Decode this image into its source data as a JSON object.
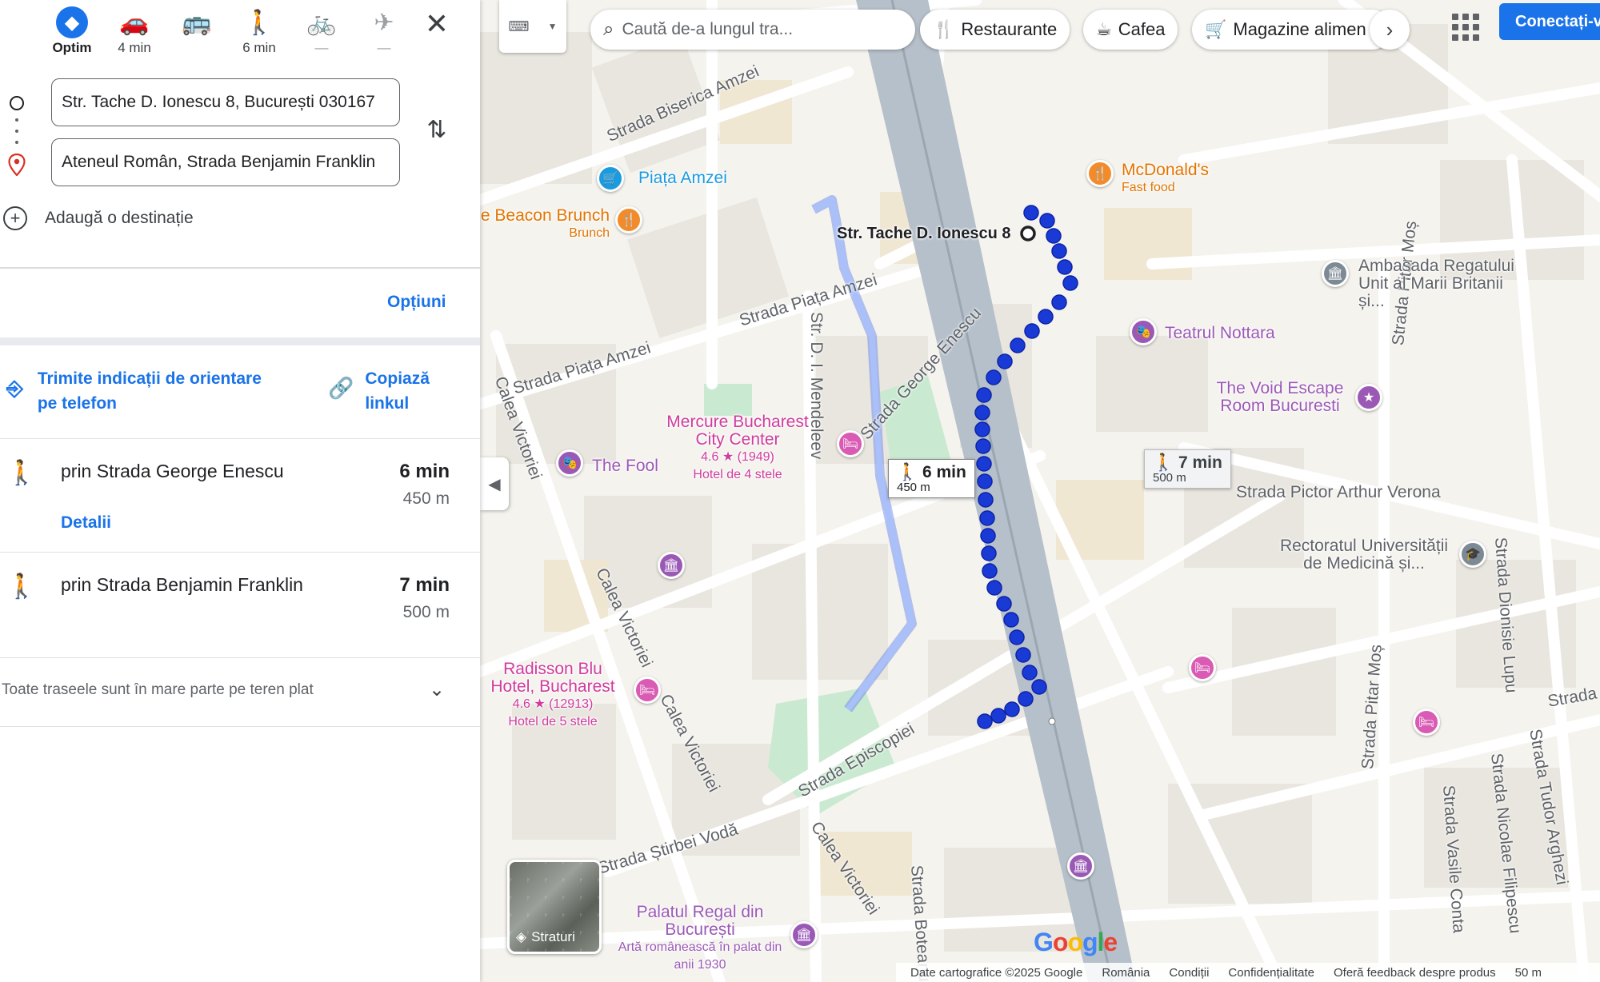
{
  "travel_modes": [
    {
      "id": "best",
      "label": "Optim",
      "icon": "directions-icon",
      "state": "active"
    },
    {
      "id": "car",
      "label": "4 min",
      "icon": "car-icon",
      "state": "normal"
    },
    {
      "id": "transit",
      "label": "",
      "icon": "bus-icon",
      "state": "normal"
    },
    {
      "id": "walk",
      "label": "6 min",
      "icon": "walk-icon",
      "state": "normal"
    },
    {
      "id": "bike",
      "label": "—",
      "icon": "bike-icon",
      "state": "disabled"
    },
    {
      "id": "flight",
      "label": "—",
      "icon": "plane-icon",
      "state": "disabled"
    }
  ],
  "directions": {
    "origin": "Str. Tache D. Ionescu 8, București 030167",
    "destination": "Ateneul Român, Strada Benjamin Franklin",
    "add_destination": "Adaugă o destinație",
    "options_label": "Opțiuni",
    "send_to_phone": "Trimite indicații de orientare pe telefon",
    "copy_link": "Copiază linkul"
  },
  "routes": [
    {
      "via": "prin Strada George Enescu",
      "time": "6 min",
      "distance": "450 m",
      "details": "Detalii"
    },
    {
      "via": "prin Strada Benjamin Franklin",
      "time": "7 min",
      "distance": "500 m"
    }
  ],
  "terrain_note": "Toate traseele sunt în mare parte pe teren plat",
  "map": {
    "search_placeholder": "Caută de-a lungul tra...",
    "chips": [
      {
        "label": "Restaurante",
        "icon": "restaurant-icon"
      },
      {
        "label": "Cafea",
        "icon": "coffee-icon"
      },
      {
        "label": "Magazine alimen",
        "icon": "cart-icon"
      }
    ],
    "sign_in": "Conectați-v",
    "layers_label": "Straturi",
    "origin_label": "Str. Tache D. Ionescu 8",
    "route_primary": {
      "time": "6 min",
      "distance": "450 m"
    },
    "route_alt": {
      "time": "7 min",
      "distance": "500 m"
    },
    "streets": [
      "Strada Biserica Amzei",
      "Strada Piața Amzei",
      "Strada Piața Amzei",
      "Calea Victoriei",
      "Calea Victoriei",
      "Calea Victoriei",
      "Calea Victoriei",
      "Str. D. I. Mendeleev",
      "Strada George Enescu",
      "Strada Pictor Arthur Verona",
      "Strada Episcopiei",
      "Strada Știrbei Vodă",
      "Strada Pitar Moș",
      "Strada Pitar Moș",
      "Strada Dionisie Lupu",
      "Strada Vasile Conta",
      "Strada Nicolae Filipescu",
      "Strada Tudor Arghezi",
      "Strada Boteanu",
      "Strada"
    ],
    "pois": [
      {
        "name": "Piața Amzei",
        "sub": "",
        "color": "#1a9be0"
      },
      {
        "name": "McDonald's",
        "sub": "Fast food",
        "color": "#e37400"
      },
      {
        "name": "e Beacon Brunch",
        "sub": "Brunch",
        "color": "#e37400"
      },
      {
        "name": "Ambasada Regatului Unit al Marii Britanii și...",
        "sub": "",
        "color": "#5f6368"
      },
      {
        "name": "Teatrul Nottara",
        "sub": "",
        "color": "#9b59b6"
      },
      {
        "name": "The Void Escape Room Bucuresti",
        "sub": "",
        "color": "#9b59b6"
      },
      {
        "name": "Mercure Bucharest City Center",
        "sub": "4.6 ★ (1949)",
        "sub2": "Hotel de 4 stele",
        "color": "#d03b9e"
      },
      {
        "name": "The Fool",
        "sub": "",
        "color": "#9b59b6"
      },
      {
        "name": "Rectoratul Universității de Medicină și...",
        "sub": "",
        "color": "#5f6368"
      },
      {
        "name": "Radisson Blu Hotel, Bucharest",
        "sub": "4.6 ★ (12913)",
        "sub2": "Hotel de 5 stele",
        "color": "#d03b9e"
      },
      {
        "name": "Palatul Regal din București",
        "sub": "Artă românească în palat din anii 1930",
        "color": "#9b59b6"
      }
    ],
    "google_logo": "Google",
    "footer": [
      "Date cartografice ©2025 Google",
      "România",
      "Condiții",
      "Confidențialitate",
      "Oferă feedback despre produs",
      "50 m"
    ]
  },
  "colors": {
    "accent": "#1a73e8",
    "route": "#1a3ad6",
    "alt_route": "#8fa8f5"
  }
}
